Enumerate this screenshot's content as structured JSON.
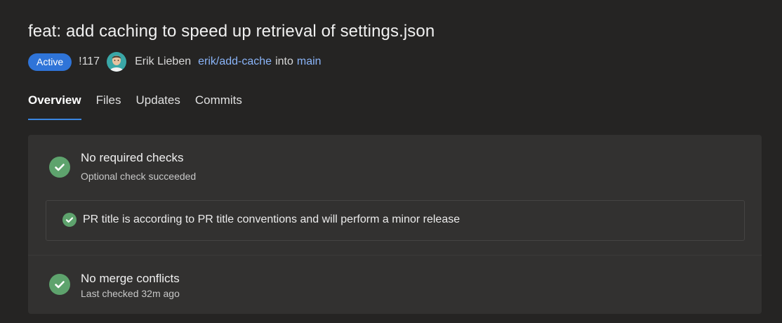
{
  "pr": {
    "title": "feat: add caching to speed up retrieval of settings.json",
    "status": "Active",
    "id": "!117",
    "author": "Erik Lieben",
    "source_branch": "erik/add-cache",
    "into": "into",
    "target_branch": "main"
  },
  "tabs": [
    {
      "label": "Overview",
      "active": true
    },
    {
      "label": "Files",
      "active": false
    },
    {
      "label": "Updates",
      "active": false
    },
    {
      "label": "Commits",
      "active": false
    }
  ],
  "checks": {
    "required": {
      "title": "No required checks",
      "subtitle": "Optional check succeeded",
      "icon": "check-circle-icon"
    },
    "optional_item": {
      "text": "PR title is according to PR title conventions and will perform a minor release",
      "icon": "check-circle-icon"
    },
    "merge": {
      "title": "No merge conflicts",
      "subtitle": "Last checked 32m ago",
      "icon": "check-circle-icon"
    }
  },
  "colors": {
    "background": "#252423",
    "panel": "#323130",
    "accent": "#2f74d8",
    "link": "#8ab4f8",
    "success": "#5ea36d"
  }
}
